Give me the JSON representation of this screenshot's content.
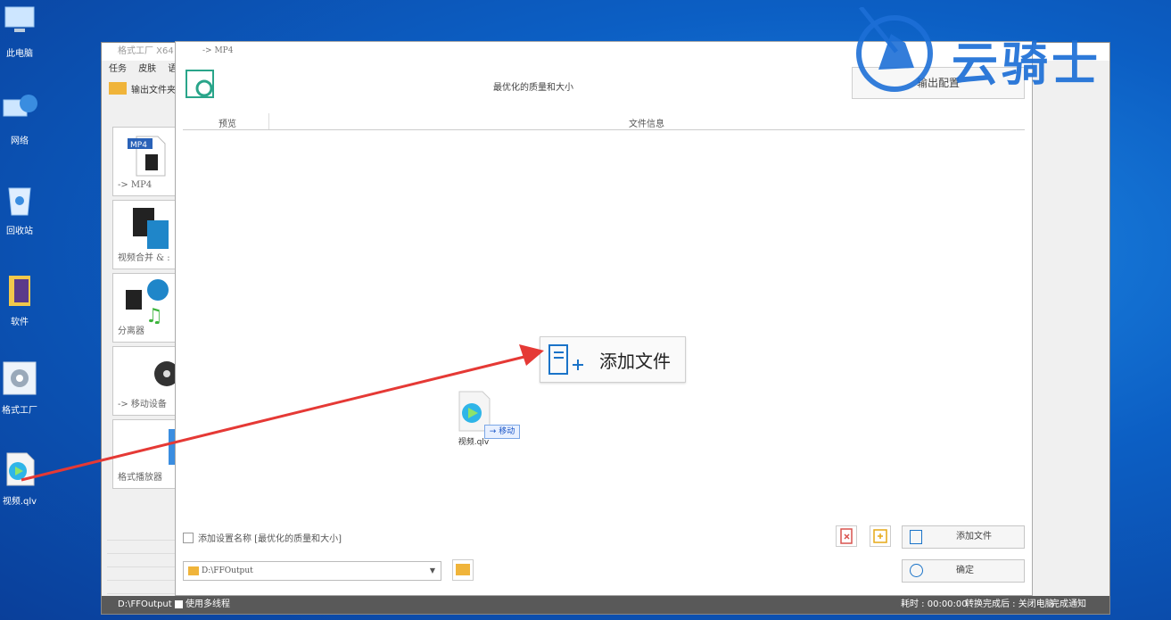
{
  "desktop": {
    "icons": [
      {
        "label": "此电脑",
        "icon": "computer-icon"
      },
      {
        "label": "网络",
        "icon": "network-icon"
      },
      {
        "label": "回收站",
        "icon": "recycle-bin-icon"
      },
      {
        "label": "软件",
        "icon": "folder-icon"
      },
      {
        "label": "格式工厂",
        "icon": "format-factory-icon"
      },
      {
        "label": "视频.qlv",
        "icon": "video-file-icon"
      }
    ]
  },
  "app": {
    "title": "格式工厂 X64 5",
    "menu": [
      "任务",
      "皮肤",
      "语"
    ],
    "toolbar_output_folder": "输出文件夹",
    "tiles": [
      {
        "label": "-> MP4"
      },
      {
        "label": "视频合并 & :"
      },
      {
        "label": "分离器"
      },
      {
        "label": "-> 移动设备"
      },
      {
        "label": "格式播放器"
      }
    ],
    "status": {
      "path": "D:\\FFOutput",
      "multithread": "使用多线程",
      "elapsed": "耗时 : 00:00:00",
      "after_done": "转换完成后 : 关闭电脑",
      "notify": "完成通知"
    }
  },
  "dialog": {
    "title": "-> MP4",
    "subtitle": "最优化的质量和大小",
    "output_config": "输出配置",
    "col_preview": "预览",
    "col_info": "文件信息",
    "add_file_big": "添加文件",
    "drag_file_name": "视频.qlv",
    "drag_action": "→ 移动",
    "save_name_checkbox": "添加设置名称 [最优化的质量和大小]",
    "add_file_button": "添加文件",
    "ok_button": "确定",
    "output_path": "D:\\FFOutput"
  },
  "watermark": {
    "text": "云骑士"
  },
  "colors": {
    "accent_green": "#2aa58a",
    "drag_arrow": "#e53935",
    "watermark_blue": "#1d6fd6"
  }
}
